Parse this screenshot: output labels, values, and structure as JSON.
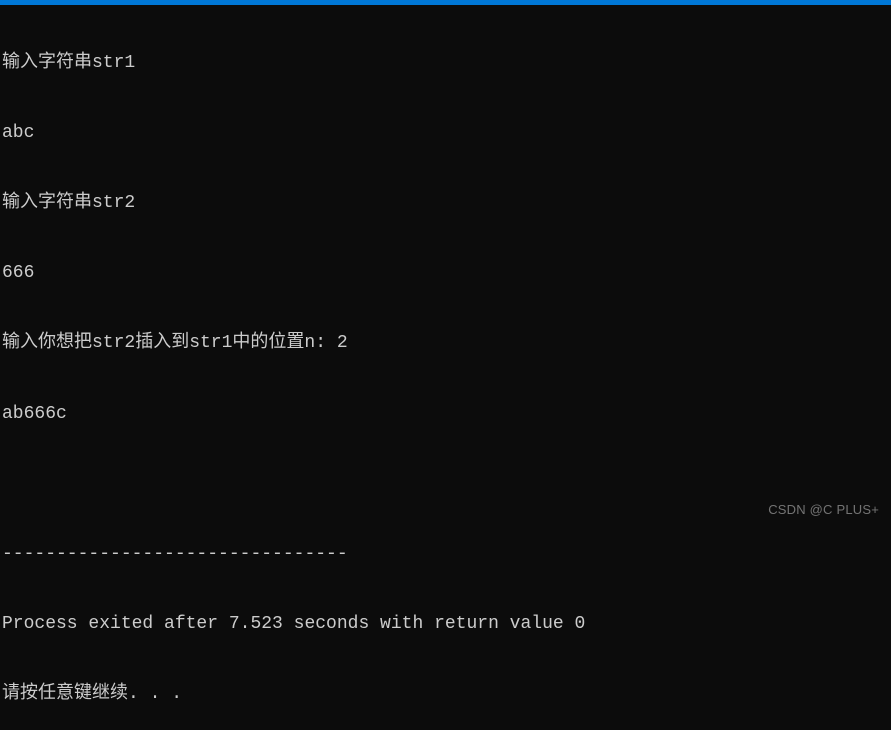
{
  "console": {
    "lines": [
      "输入字符串str1",
      "abc",
      "输入字符串str2",
      "666",
      "输入你想把str2插入到str1中的位置n: 2",
      "ab666c",
      "",
      "--------------------------------",
      "Process exited after 7.523 seconds with return value 0",
      "请按任意键继续. . ."
    ]
  },
  "watermark": "CSDN @C PLUS+"
}
